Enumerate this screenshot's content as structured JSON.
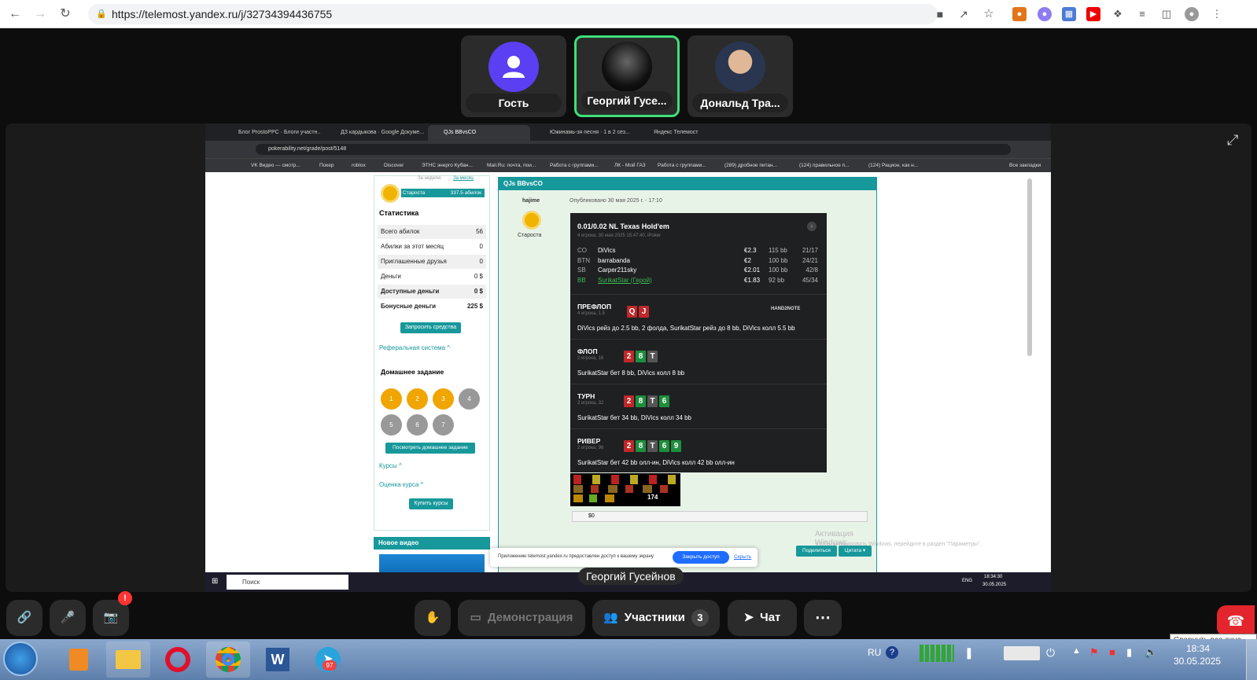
{
  "browser": {
    "url": "https://telemost.yandex.ru/j/32734394436755"
  },
  "participants": [
    {
      "name": "Гость"
    },
    {
      "name": "Георгий Гусе..."
    },
    {
      "name": "Дональд Тра..."
    }
  ],
  "shared_screen": {
    "tabs": [
      "Блог ProstoPPC · Блоги участн...",
      "ДЗ кардыкова · Google Докуме...",
      "QJs BBvsCO",
      "Южинамь-зя песня · 1 в 2 сез...",
      "Яндекс Телемост"
    ],
    "address": "pokerability.net/grade/post/5148",
    "bookmarks": [
      "VK Видео — смотр...",
      "Покер",
      "roblox",
      "Discover",
      "ЭТНС энерго Кубан...",
      "Mail.Ru: почта, пои...",
      "Работа с группами...",
      "ЛК - Мой ГАЗ",
      "Работа с группами...",
      "(289) дробное питан...",
      "(124) правильное п...",
      "(124) Рацион, как н..."
    ],
    "bookmarks_all": "Все закладки",
    "sidebar": {
      "period_week": "За неделю",
      "period_month": "За месяц",
      "rank": "Староста",
      "rank_amount": "337.5 абилок",
      "stats_title": "Статистика",
      "rows": [
        {
          "label": "Всего абилок",
          "value": "56"
        },
        {
          "label": "Абилки за этот месяц",
          "value": "0"
        },
        {
          "label": "Приглашенные друзья",
          "value": "0"
        },
        {
          "label": "Деньги",
          "value": "0 $"
        },
        {
          "label": "Доступные деньги",
          "value": "0 $"
        },
        {
          "label": "Бонусные деньги",
          "value": "225 $"
        }
      ],
      "request_btn": "Запросить средства",
      "referral": "Реферальная система ^",
      "homework_title": "Домашнее задание",
      "homework": [
        "1",
        "2",
        "3",
        "4",
        "5",
        "6",
        "7"
      ],
      "view_homework_btn": "Посмотреть домашнее задание",
      "courses": "Курсы ^",
      "rate_course": "Оценка курса ^",
      "buy_btn": "Купить курсы",
      "new_video": "Новое видео"
    },
    "post": {
      "title": "QJs BBvsCO",
      "author": "hajime",
      "author_rank": "Староста",
      "published": "Опубликовано 30 мая 2025 г. - 17:10",
      "game": "0.01/0.02 NL Texas Hold'em",
      "game_sub": "4 игрока, 30 мая 2025 15:47:40, iPoker",
      "players": [
        {
          "pos": "CO",
          "name": "DiVics",
          "stack": "€2.3",
          "bb": "115 bb",
          "stat": "21/17"
        },
        {
          "pos": "BTN",
          "name": "barrabanda",
          "stack": "€2",
          "bb": "100 bb",
          "stat": "24/21"
        },
        {
          "pos": "SB",
          "name": "Carper211sky",
          "stack": "€2.01",
          "bb": "100 bb",
          "stat": "42/8"
        },
        {
          "pos": "BB",
          "name": "SurikatStar (Герой)",
          "stack": "€1.83",
          "bb": "92 bb",
          "stat": "45/34"
        }
      ],
      "streets": [
        {
          "name": "ПРЕФЛОП",
          "sub": "4 игрока, 1.5",
          "action": "DiVics рейз до 2.5 bb, 2 фолда, SurikatStar рейз до 8 bb, DiVics колл 5.5 bb"
        },
        {
          "name": "ФЛОП",
          "sub": "2 игрока, 16",
          "action": "SurikatStar бет 8 bb, DiVics колл 8 bb"
        },
        {
          "name": "ТУРН",
          "sub": "2 игрока, 32",
          "action": "SurikatStar бет 34 bb, DiVics колл 34 bb"
        },
        {
          "name": "РИВЕР",
          "sub": "2 игрока, 96",
          "action": "SurikatStar бет 42 bb олл-ин, DiVics колл 42 bb олл-ин"
        }
      ],
      "hud_brand": "HAND2NOTE",
      "hud_total": "174",
      "result": "$0",
      "share_btn": "Поделиться",
      "quote_btn": "Цитата ▾",
      "activation_title": "Активация Windows",
      "activation_sub": "Чтобы активировать Windows, перейдите в раздел \"Параметры\"."
    },
    "notice": {
      "text": "Приложению telemost.yandex.ru предоставлен доступ к вашему экрану.",
      "close_btn": "Закрыть доступ",
      "hide": "Скрыть"
    },
    "win10_taskbar": {
      "search": "Поиск",
      "lang": "ENG",
      "time": "18:34:30",
      "date": "30.05.2025"
    },
    "speaker": "Георгий Гусейнов"
  },
  "controls": {
    "demo": "Демонстрация",
    "participants": "Участники",
    "participants_count": "3",
    "chat": "Чат",
    "badge": "!",
    "tooltip": "Свернуть все окна"
  },
  "taskbar": {
    "lang": "RU",
    "time": "18:34",
    "date": "30.05.2025",
    "telegram_badge": "97"
  }
}
